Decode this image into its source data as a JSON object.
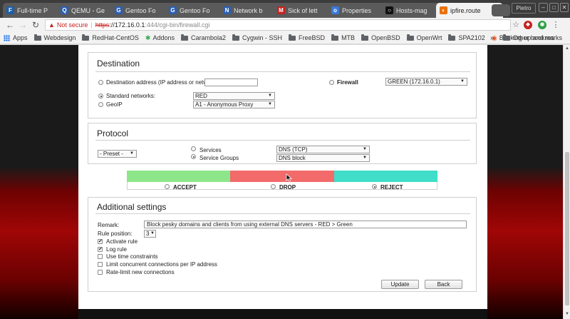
{
  "browser": {
    "tabs": [
      {
        "title": "Full-time P",
        "favicon": "F",
        "favicon_color": "#1e5fa8"
      },
      {
        "title": "QEMU - Ge",
        "favicon": "Q",
        "favicon_color": "#2d5fb0"
      },
      {
        "title": "Gentoo Fo",
        "favicon": "G",
        "favicon_color": "#2d5fb0"
      },
      {
        "title": "Gentoo Fo",
        "favicon": "G",
        "favicon_color": "#2d5fb0"
      },
      {
        "title": "Network b",
        "favicon": "N",
        "favicon_color": "#2d5fb0"
      },
      {
        "title": "Sick of lett",
        "favicon": "M",
        "favicon_color": "#c5221f"
      },
      {
        "title": "Properties",
        "favicon": "o",
        "favicon_color": "#3b78d8"
      },
      {
        "title": "Hosts-mag",
        "favicon": "○",
        "favicon_color": "#111111"
      },
      {
        "title": "ipfire.route",
        "favicon": "◐",
        "favicon_color": "#e8710a",
        "active": true
      }
    ],
    "profile_label": "Pietro",
    "window_buttons": [
      "–",
      "□",
      "✕"
    ],
    "address": {
      "security_label": "Not secure",
      "scheme": "https",
      "host": "://172.16.0.1",
      "path": ":444/cgi-bin/firewall.cgi"
    },
    "bookmarks": [
      {
        "label": "Apps",
        "icon": "apps-grid-icon"
      },
      {
        "label": "Webdesign",
        "icon": "folder-icon"
      },
      {
        "label": "RedHat-CentOS",
        "icon": "folder-icon"
      },
      {
        "label": "Addons",
        "icon": "puzzle-icon"
      },
      {
        "label": "Carambola2",
        "icon": "folder-icon"
      },
      {
        "label": "Cygwin - SSH",
        "icon": "folder-icon"
      },
      {
        "label": "FreeBSD",
        "icon": "folder-icon"
      },
      {
        "label": "MTB",
        "icon": "folder-icon"
      },
      {
        "label": "OpenBSD",
        "icon": "folder-icon"
      },
      {
        "label": "OpenWrt",
        "icon": "folder-icon"
      },
      {
        "label": "SPA2102",
        "icon": "folder-icon"
      },
      {
        "label": "Backing up and res",
        "icon": "ubuntu-icon"
      }
    ],
    "bookmarks_more": "»",
    "other_bookmarks": "Other bookmarks"
  },
  "destination": {
    "title": "Destination",
    "address_label": "Destination address (IP address or network):",
    "address_value": "",
    "firewall_label": "Firewall",
    "firewall_select": "GREEN (172.16.0.1)",
    "standard_networks_label": "Standard networks:",
    "standard_networks_select": "RED",
    "geoip_label": "GeoIP",
    "geoip_select": "A1 - Anonymous Proxy"
  },
  "protocol": {
    "title": "Protocol",
    "preset_select": "- Preset -",
    "services_label": "Services",
    "services_select": "DNS (TCP)",
    "service_groups_label": "Service Groups",
    "service_groups_select": "DNS block"
  },
  "policy": {
    "accept_label": "ACCEPT",
    "drop_label": "DROP",
    "reject_label": "REJECT",
    "selected": "REJECT",
    "colors": {
      "accept": "#8ee68a",
      "drop": "#f26a6a",
      "reject": "#40ddc8"
    }
  },
  "additional": {
    "title": "Additional settings",
    "remark_label": "Remark:",
    "remark_value": "Block pesky domains and clients from using external DNS servers - RED > Green",
    "rule_position_label": "Rule position:",
    "rule_position_value": "3",
    "options": [
      {
        "label": "Activate rule",
        "checked": true
      },
      {
        "label": "Log rule",
        "checked": true
      },
      {
        "label": "Use time constraints",
        "checked": false
      },
      {
        "label": "Limit concurrent connections per IP address",
        "checked": false
      },
      {
        "label": "Rate-limit new connections",
        "checked": false
      }
    ],
    "update_button": "Update",
    "back_button": "Back"
  }
}
